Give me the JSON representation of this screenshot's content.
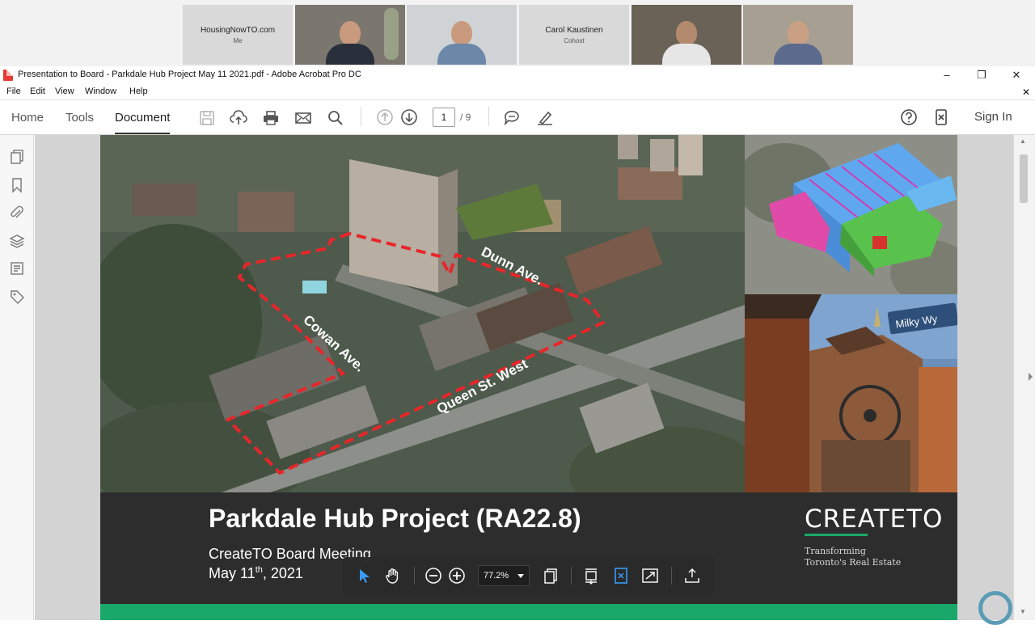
{
  "video_strip": {
    "tiles": [
      {
        "name": "HousingNowTO.com",
        "role": "Me"
      },
      {
        "name": "",
        "role": ""
      },
      {
        "name": "",
        "role": ""
      },
      {
        "name": "Carol Kaustinen",
        "role": "Cohost"
      },
      {
        "name": "",
        "role": ""
      },
      {
        "name": "",
        "role": ""
      }
    ]
  },
  "window": {
    "title": "Presentation to Board - Parkdale Hub Project May 11 2021.pdf - Adobe Acrobat Pro DC",
    "minimize": "–",
    "restore": "❐",
    "close": "✕",
    "doc_close": "✕"
  },
  "menu": [
    "File",
    "Edit",
    "View",
    "Window",
    "Help"
  ],
  "toolbar": {
    "tabs": [
      "Home",
      "Tools",
      "Document"
    ],
    "active_tab": "Document",
    "page_current": "1",
    "page_total": "/ 9",
    "sign_in": "Sign In"
  },
  "slide": {
    "street_labels": [
      "Dunn Ave.",
      "Cowan Ave.",
      "Queen St. West"
    ],
    "sign_text": "Milky Wy",
    "title": "Parkdale Hub Project (RA22.8)",
    "subtitle": "CreateTO Board Meeting",
    "date_day": "May 11",
    "date_sup": "th",
    "date_year": ", 2021",
    "logo_word": "CREATETO",
    "logo_tag1": "Transforming",
    "logo_tag2": "Toronto's Real Estate",
    "colors": {
      "band": "#1aa86a",
      "footer": "#2d2d2d",
      "boundary": "#e8262a"
    }
  },
  "float_toolbar": {
    "zoom": "77.2%"
  }
}
